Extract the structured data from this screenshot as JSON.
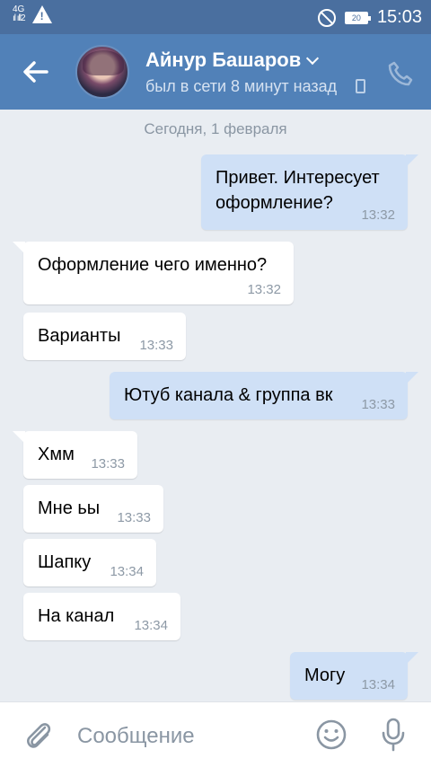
{
  "status_bar": {
    "network": "4G",
    "time": "15:03",
    "battery": "20"
  },
  "header": {
    "name": "Айнур Башаров",
    "status": "был в сети 8 минут назад",
    "icons": {
      "back": "back-arrow-icon",
      "phone": "phone-icon",
      "device": "mobile-device-icon",
      "chevron": "chevron-down-icon"
    }
  },
  "chat": {
    "date": "Сегодня, 1 февраля",
    "messages": [
      {
        "dir": "out",
        "lines": [
          "Привет. Интересует",
          "оформление?"
        ],
        "time": "13:32"
      },
      {
        "dir": "in",
        "lines": [
          "Оформление чего именно?"
        ],
        "time": "13:32"
      },
      {
        "dir": "in",
        "lines": [
          "Варианты"
        ],
        "time": "13:33"
      },
      {
        "dir": "out",
        "lines": [
          "Ютуб канала & группа вк"
        ],
        "time": "13:33"
      },
      {
        "dir": "in",
        "lines": [
          "Хмм"
        ],
        "time": "13:33"
      },
      {
        "dir": "in",
        "lines": [
          "Мне ьы"
        ],
        "time": "13:33"
      },
      {
        "dir": "in",
        "lines": [
          "Шапку"
        ],
        "time": "13:34"
      },
      {
        "dir": "in",
        "lines": [
          "На канал"
        ],
        "time": "13:34"
      },
      {
        "dir": "out",
        "lines": [
          "Могу"
        ],
        "time": "13:34"
      }
    ]
  },
  "composer": {
    "placeholder": "Сообщение",
    "icons": {
      "attach": "paperclip-icon",
      "emoji": "smiley-icon",
      "mic": "microphone-icon"
    }
  }
}
